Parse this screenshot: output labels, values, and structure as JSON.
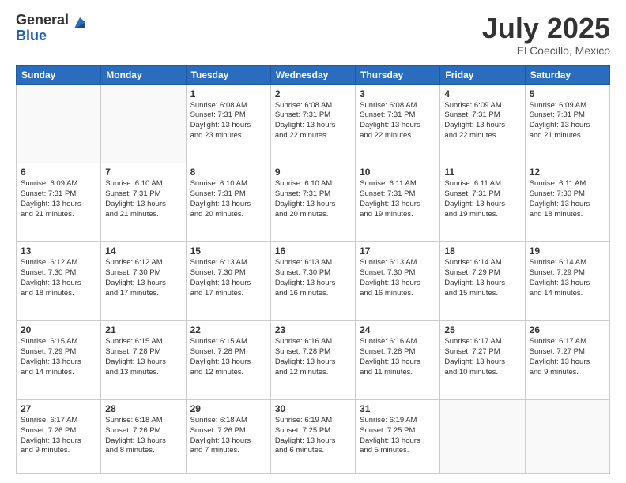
{
  "logo": {
    "general": "General",
    "blue": "Blue"
  },
  "title": {
    "month": "July 2025",
    "location": "El Coecillo, Mexico"
  },
  "weekdays": [
    "Sunday",
    "Monday",
    "Tuesday",
    "Wednesday",
    "Thursday",
    "Friday",
    "Saturday"
  ],
  "weeks": [
    [
      {
        "day": "",
        "info": ""
      },
      {
        "day": "",
        "info": ""
      },
      {
        "day": "1",
        "info": "Sunrise: 6:08 AM\nSunset: 7:31 PM\nDaylight: 13 hours\nand 23 minutes."
      },
      {
        "day": "2",
        "info": "Sunrise: 6:08 AM\nSunset: 7:31 PM\nDaylight: 13 hours\nand 22 minutes."
      },
      {
        "day": "3",
        "info": "Sunrise: 6:08 AM\nSunset: 7:31 PM\nDaylight: 13 hours\nand 22 minutes."
      },
      {
        "day": "4",
        "info": "Sunrise: 6:09 AM\nSunset: 7:31 PM\nDaylight: 13 hours\nand 22 minutes."
      },
      {
        "day": "5",
        "info": "Sunrise: 6:09 AM\nSunset: 7:31 PM\nDaylight: 13 hours\nand 21 minutes."
      }
    ],
    [
      {
        "day": "6",
        "info": "Sunrise: 6:09 AM\nSunset: 7:31 PM\nDaylight: 13 hours\nand 21 minutes."
      },
      {
        "day": "7",
        "info": "Sunrise: 6:10 AM\nSunset: 7:31 PM\nDaylight: 13 hours\nand 21 minutes."
      },
      {
        "day": "8",
        "info": "Sunrise: 6:10 AM\nSunset: 7:31 PM\nDaylight: 13 hours\nand 20 minutes."
      },
      {
        "day": "9",
        "info": "Sunrise: 6:10 AM\nSunset: 7:31 PM\nDaylight: 13 hours\nand 20 minutes."
      },
      {
        "day": "10",
        "info": "Sunrise: 6:11 AM\nSunset: 7:31 PM\nDaylight: 13 hours\nand 19 minutes."
      },
      {
        "day": "11",
        "info": "Sunrise: 6:11 AM\nSunset: 7:31 PM\nDaylight: 13 hours\nand 19 minutes."
      },
      {
        "day": "12",
        "info": "Sunrise: 6:11 AM\nSunset: 7:30 PM\nDaylight: 13 hours\nand 18 minutes."
      }
    ],
    [
      {
        "day": "13",
        "info": "Sunrise: 6:12 AM\nSunset: 7:30 PM\nDaylight: 13 hours\nand 18 minutes."
      },
      {
        "day": "14",
        "info": "Sunrise: 6:12 AM\nSunset: 7:30 PM\nDaylight: 13 hours\nand 17 minutes."
      },
      {
        "day": "15",
        "info": "Sunrise: 6:13 AM\nSunset: 7:30 PM\nDaylight: 13 hours\nand 17 minutes."
      },
      {
        "day": "16",
        "info": "Sunrise: 6:13 AM\nSunset: 7:30 PM\nDaylight: 13 hours\nand 16 minutes."
      },
      {
        "day": "17",
        "info": "Sunrise: 6:13 AM\nSunset: 7:30 PM\nDaylight: 13 hours\nand 16 minutes."
      },
      {
        "day": "18",
        "info": "Sunrise: 6:14 AM\nSunset: 7:29 PM\nDaylight: 13 hours\nand 15 minutes."
      },
      {
        "day": "19",
        "info": "Sunrise: 6:14 AM\nSunset: 7:29 PM\nDaylight: 13 hours\nand 14 minutes."
      }
    ],
    [
      {
        "day": "20",
        "info": "Sunrise: 6:15 AM\nSunset: 7:29 PM\nDaylight: 13 hours\nand 14 minutes."
      },
      {
        "day": "21",
        "info": "Sunrise: 6:15 AM\nSunset: 7:28 PM\nDaylight: 13 hours\nand 13 minutes."
      },
      {
        "day": "22",
        "info": "Sunrise: 6:15 AM\nSunset: 7:28 PM\nDaylight: 13 hours\nand 12 minutes."
      },
      {
        "day": "23",
        "info": "Sunrise: 6:16 AM\nSunset: 7:28 PM\nDaylight: 13 hours\nand 12 minutes."
      },
      {
        "day": "24",
        "info": "Sunrise: 6:16 AM\nSunset: 7:28 PM\nDaylight: 13 hours\nand 11 minutes."
      },
      {
        "day": "25",
        "info": "Sunrise: 6:17 AM\nSunset: 7:27 PM\nDaylight: 13 hours\nand 10 minutes."
      },
      {
        "day": "26",
        "info": "Sunrise: 6:17 AM\nSunset: 7:27 PM\nDaylight: 13 hours\nand 9 minutes."
      }
    ],
    [
      {
        "day": "27",
        "info": "Sunrise: 6:17 AM\nSunset: 7:26 PM\nDaylight: 13 hours\nand 9 minutes."
      },
      {
        "day": "28",
        "info": "Sunrise: 6:18 AM\nSunset: 7:26 PM\nDaylight: 13 hours\nand 8 minutes."
      },
      {
        "day": "29",
        "info": "Sunrise: 6:18 AM\nSunset: 7:26 PM\nDaylight: 13 hours\nand 7 minutes."
      },
      {
        "day": "30",
        "info": "Sunrise: 6:19 AM\nSunset: 7:25 PM\nDaylight: 13 hours\nand 6 minutes."
      },
      {
        "day": "31",
        "info": "Sunrise: 6:19 AM\nSunset: 7:25 PM\nDaylight: 13 hours\nand 5 minutes."
      },
      {
        "day": "",
        "info": ""
      },
      {
        "day": "",
        "info": ""
      }
    ]
  ]
}
